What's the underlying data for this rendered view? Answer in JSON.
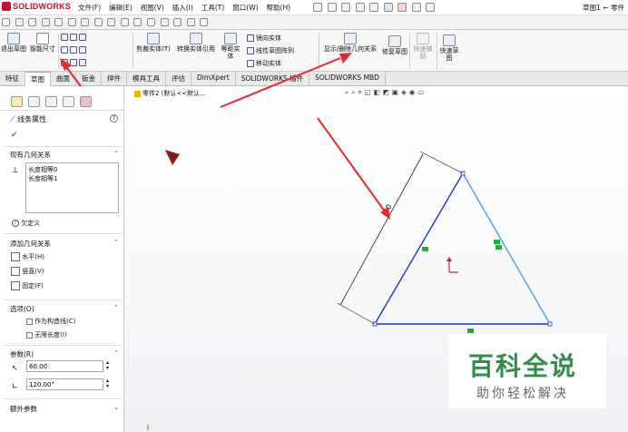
{
  "app": {
    "logo": "SOLIDWORKS",
    "doc_title": "草图1 ← 零件"
  },
  "menu": [
    "文件(F)",
    "编辑(E)",
    "视图(V)",
    "插入(I)",
    "工具(T)",
    "窗口(W)",
    "帮助(H)"
  ],
  "ribbon": {
    "exit_sketch": "退出草图",
    "smart_dimension": "智能尺寸",
    "trim": "剪裁实体(T)",
    "convert": "转换实体引用",
    "offset": "等距实体",
    "mirror": "镜向实体",
    "linear_pattern": "线性草图阵列",
    "move": "移动实体",
    "show_relations": "显示/删除几何关系",
    "repair": "修复草图",
    "quick_snaps": "快速捕捉",
    "rapid_sketch": "快速草图"
  },
  "tabs": [
    "特征",
    "草图",
    "曲面",
    "钣金",
    "焊件",
    "模具工具",
    "评估",
    "DimXpert",
    "SOLIDWORKS 插件",
    "SOLIDWORKS MBD"
  ],
  "tree_tip": "零件2 (默认<<默认...",
  "panel": {
    "title": "线条属性",
    "existing_relations_header": "现有几何关系",
    "relations": [
      "长度相等0",
      "长度相等1"
    ],
    "status": "欠定义",
    "add_relations_header": "添加几何关系",
    "add_relations": [
      "水平(H)",
      "竖直(V)",
      "固定(F)"
    ],
    "options_header": "选项(O)",
    "options": [
      "作为构造线(C)",
      "无限长度(I)"
    ],
    "params_header": "参数(R)",
    "length_value": "60.00",
    "angle_value": "120.00°",
    "extra_params_header": "额外参数"
  },
  "sketch": {
    "dimension_label": "60",
    "line_color_selected": "#1a33c8",
    "line_color_other": "#4aa0e8",
    "arrow_color": "#e02c2c"
  },
  "watermark": {
    "title": "百科全说",
    "subtitle": "助你轻松解决"
  }
}
